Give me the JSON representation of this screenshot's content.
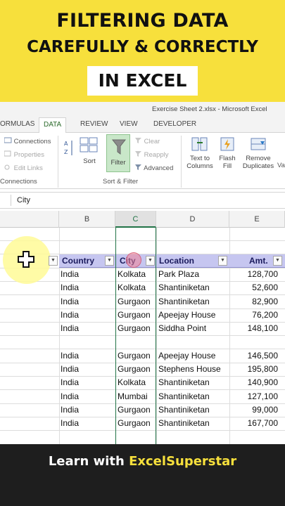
{
  "banner": {
    "line1": "FILTERING DATA",
    "line2": "CAREFULLY & CORRECTLY",
    "line3": "IN EXCEL"
  },
  "window": {
    "title": "Exercise Sheet 2.xlsx - Microsoft Excel"
  },
  "tabs": [
    "ORMULAS",
    "DATA",
    "REVIEW",
    "VIEW",
    "DEVELOPER"
  ],
  "ribbon": {
    "connections": {
      "items": [
        "Connections",
        "Properties",
        "Edit Links"
      ],
      "group": "Connections"
    },
    "sort": {
      "label": "Sort",
      "az_icon": "sort-az-icon"
    },
    "filter": {
      "label": "Filter",
      "clear": "Clear",
      "reapply": "Reapply",
      "advanced": "Advanced"
    },
    "sort_filter_group": "Sort & Filter",
    "text_to_columns": [
      "Text to",
      "Columns"
    ],
    "flash_fill": [
      "Flash",
      "Fill"
    ],
    "remove_duplicates": [
      "Remove",
      "Duplicates"
    ],
    "cut_off": "Va"
  },
  "formula_bar": {
    "value": "City"
  },
  "columns": [
    "B",
    "C",
    "D",
    "E"
  ],
  "table": {
    "headers": [
      "Country",
      "City",
      "Location",
      "Amt."
    ],
    "rows": [
      [
        "India",
        "Kolkata",
        "Park Plaza",
        "128,700"
      ],
      [
        "India",
        "Kolkata",
        "Shantiniketan",
        "52,600"
      ],
      [
        "India",
        "Gurgaon",
        "Shantiniketan",
        "82,900"
      ],
      [
        "India",
        "Gurgaon",
        "Apeejay House",
        "76,200"
      ],
      [
        "India",
        "Gurgaon",
        "Siddha Point",
        "148,100"
      ],
      [
        "",
        "",
        "",
        ""
      ],
      [
        "India",
        "Gurgaon",
        "Apeejay House",
        "146,500"
      ],
      [
        "India",
        "Gurgaon",
        "Stephens House",
        "195,800"
      ],
      [
        "India",
        "Kolkata",
        "Shantiniketan",
        "140,900"
      ],
      [
        "India",
        "Mumbai",
        "Shantiniketan",
        "127,100"
      ],
      [
        "India",
        "Gurgaon",
        "Shantiniketan",
        "99,000"
      ],
      [
        "India",
        "Gurgaon",
        "Shantiniketan",
        "167,700"
      ]
    ]
  },
  "footer": {
    "prefix": "Learn with ",
    "brand": "ExcelSuperstar"
  },
  "colors": {
    "banner": "#f7e03c",
    "excel_green": "#217346",
    "table_header": "#c6c6f0"
  }
}
